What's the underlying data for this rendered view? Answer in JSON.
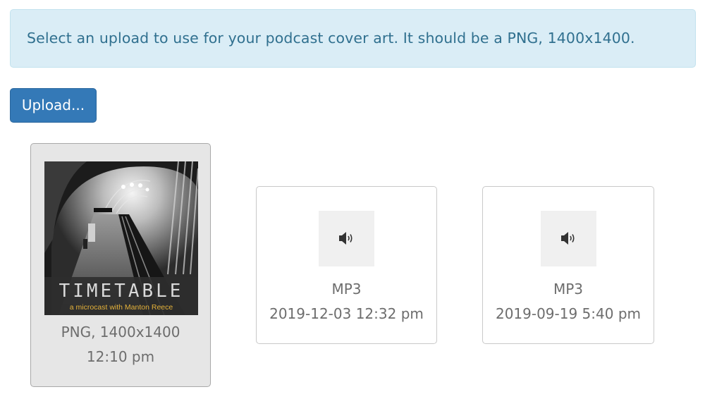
{
  "alert": {
    "message": "Select an upload to use for your podcast cover art. It should be a PNG, 1400x1400."
  },
  "upload_button": {
    "label": "Upload..."
  },
  "uploads": [
    {
      "selected": true,
      "thumbnail": "image",
      "cover_title": "TIMETABLE",
      "cover_subtitle": "a microcast with Manton Reece",
      "type_info": "PNG, 1400x1400",
      "time": "12:10 pm"
    },
    {
      "selected": false,
      "thumbnail": "speaker-icon",
      "type_info": "MP3",
      "time": "2019-12-03 12:32 pm"
    },
    {
      "selected": false,
      "thumbnail": "speaker-icon",
      "type_info": "MP3",
      "time": "2019-09-19 5:40 pm"
    }
  ],
  "colors": {
    "alert_background": "#daedf6",
    "alert_text": "#30708f",
    "button_background": "#3479b7",
    "selected_card_background": "#e6e6e6",
    "cover_subtitle": "#e5b23a"
  }
}
